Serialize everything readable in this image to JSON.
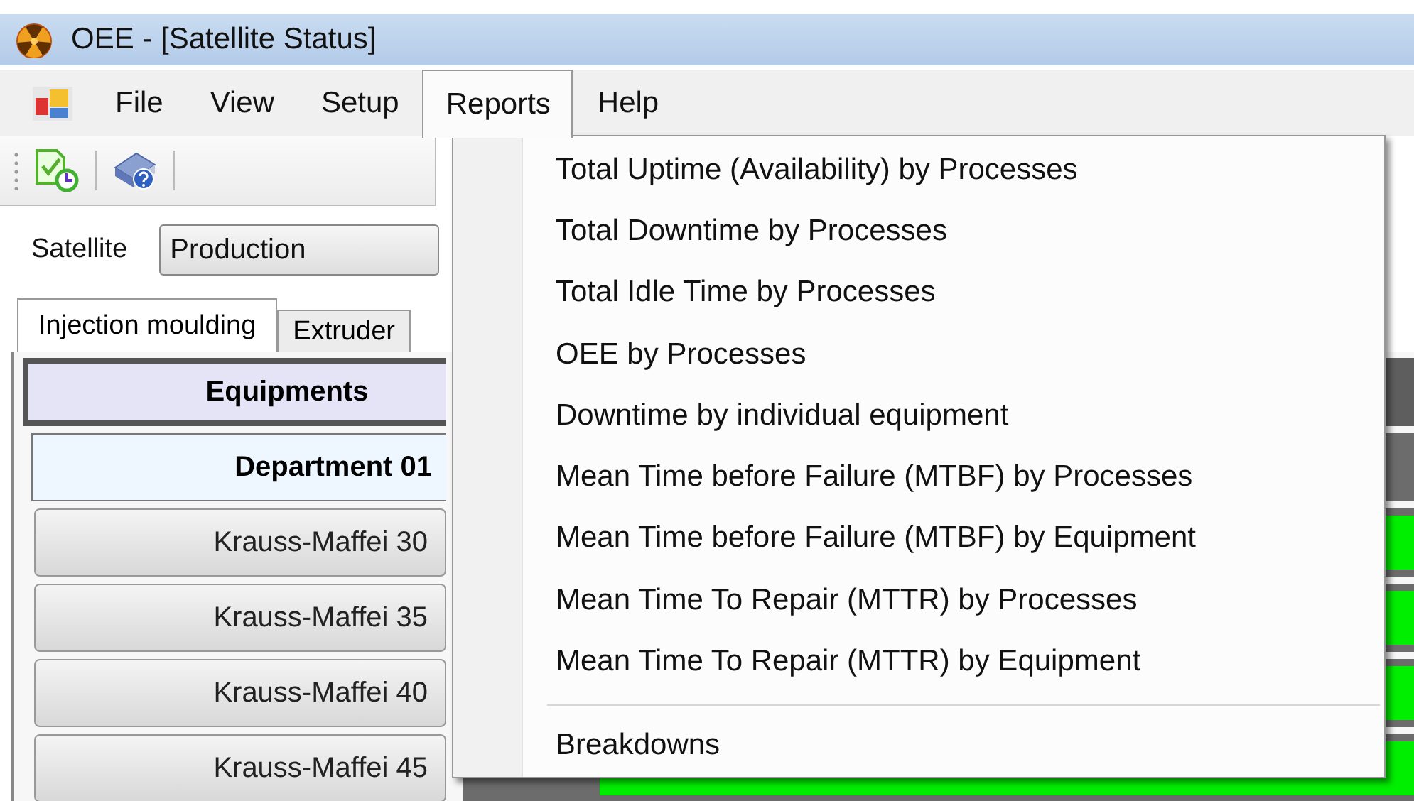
{
  "window": {
    "title": "OEE - [Satellite Status]"
  },
  "menu_bar": [
    {
      "label": "File",
      "selected": false
    },
    {
      "label": "View",
      "selected": false
    },
    {
      "label": "Setup",
      "selected": false
    },
    {
      "label": "Reports",
      "selected": true
    },
    {
      "label": "Help",
      "selected": false
    }
  ],
  "satellite": {
    "label": "Satellite",
    "value": "Production"
  },
  "tabs": [
    {
      "label": "Injection moulding",
      "selected": true
    },
    {
      "label": "Extruder",
      "selected": false
    }
  ],
  "equipment_panel": {
    "header": "Equipments",
    "department": "Department 01",
    "equipment": [
      {
        "name": "Krauss-Maffei 30",
        "color": "#00ee00"
      },
      {
        "name": "Krauss-Maffei 35",
        "color": "#00ee00"
      },
      {
        "name": "Krauss-Maffei 40",
        "color": "#00ee00"
      },
      {
        "name": "Krauss-Maffei 45",
        "color": "#00ee00"
      }
    ]
  },
  "reports_menu": [
    {
      "kind": "item",
      "label": "Total Uptime (Availability) by Processes"
    },
    {
      "kind": "item",
      "label": "Total Downtime by Processes"
    },
    {
      "kind": "item",
      "label": "Total Idle Time by Processes"
    },
    {
      "kind": "item",
      "label": "OEE by Processes"
    },
    {
      "kind": "item",
      "label": "Downtime by individual equipment"
    },
    {
      "kind": "item",
      "label": "Mean Time before Failure (MTBF) by Processes"
    },
    {
      "kind": "item",
      "label": "Mean Time before Failure (MTBF) by Equipment"
    },
    {
      "kind": "item",
      "label": "Mean Time To Repair (MTTR) by Processes"
    },
    {
      "kind": "item",
      "label": "Mean Time To Repair (MTTR) by Equipment"
    },
    {
      "kind": "separator"
    },
    {
      "kind": "item",
      "label": "Breakdowns"
    }
  ]
}
